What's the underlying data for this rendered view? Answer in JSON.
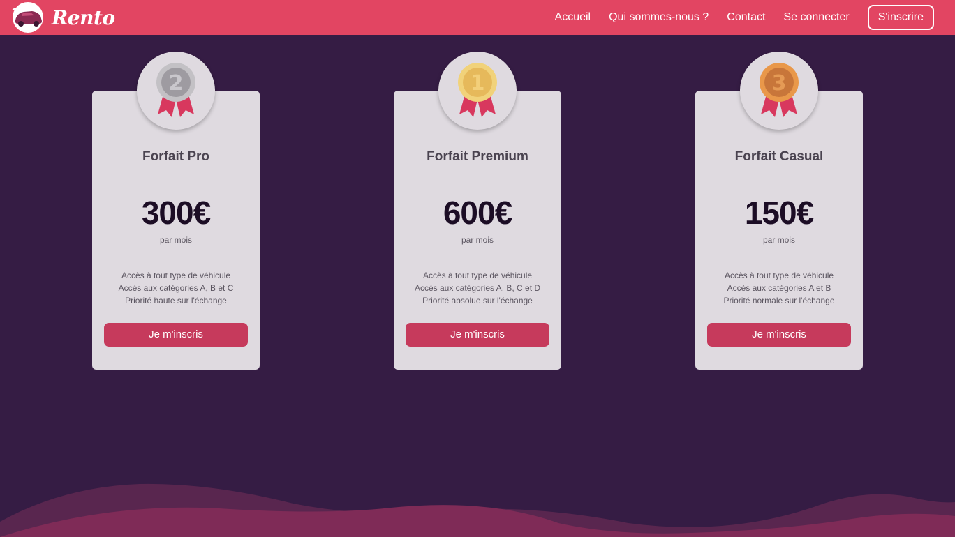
{
  "brand": {
    "name": "Rento",
    "logo_icon": "car-logo-icon"
  },
  "nav": {
    "links": [
      "Accueil",
      "Qui sommes-nous ?",
      "Contact",
      "Se connecter"
    ],
    "cta": "S'inscrire"
  },
  "colors": {
    "navbar": "#e24562",
    "background": "#351c44",
    "card": "#dfdae0",
    "button": "#c63a5c",
    "wave_light": "#59264f",
    "wave_dark": "#7f2b57",
    "medal_silver": "#a9a7ab",
    "medal_gold": "#e6b95b",
    "medal_bronze": "#d98a44"
  },
  "plans": [
    {
      "medal_icon": "silver-medal-icon",
      "rank": "2",
      "title": "Forfait Pro",
      "price": "300€",
      "period": "par mois",
      "features": [
        "Accès à tout type de véhicule",
        "Accès aux catégories A, B et C",
        "Priorité haute sur l'échange"
      ],
      "button": "Je m'inscris"
    },
    {
      "medal_icon": "gold-medal-icon",
      "rank": "1",
      "title": "Forfait Premium",
      "price": "600€",
      "period": "par mois",
      "features": [
        "Accès à tout type de véhicule",
        "Accès aux catégories A, B, C et D",
        "Priorité absolue sur l'échange"
      ],
      "button": "Je m'inscris"
    },
    {
      "medal_icon": "bronze-medal-icon",
      "rank": "3",
      "title": "Forfait Casual",
      "price": "150€",
      "period": "par mois",
      "features": [
        "Accès à tout type de véhicule",
        "Accès aux catégories A et B",
        "Priorité normale sur l'échange"
      ],
      "button": "Je m'inscris"
    }
  ]
}
